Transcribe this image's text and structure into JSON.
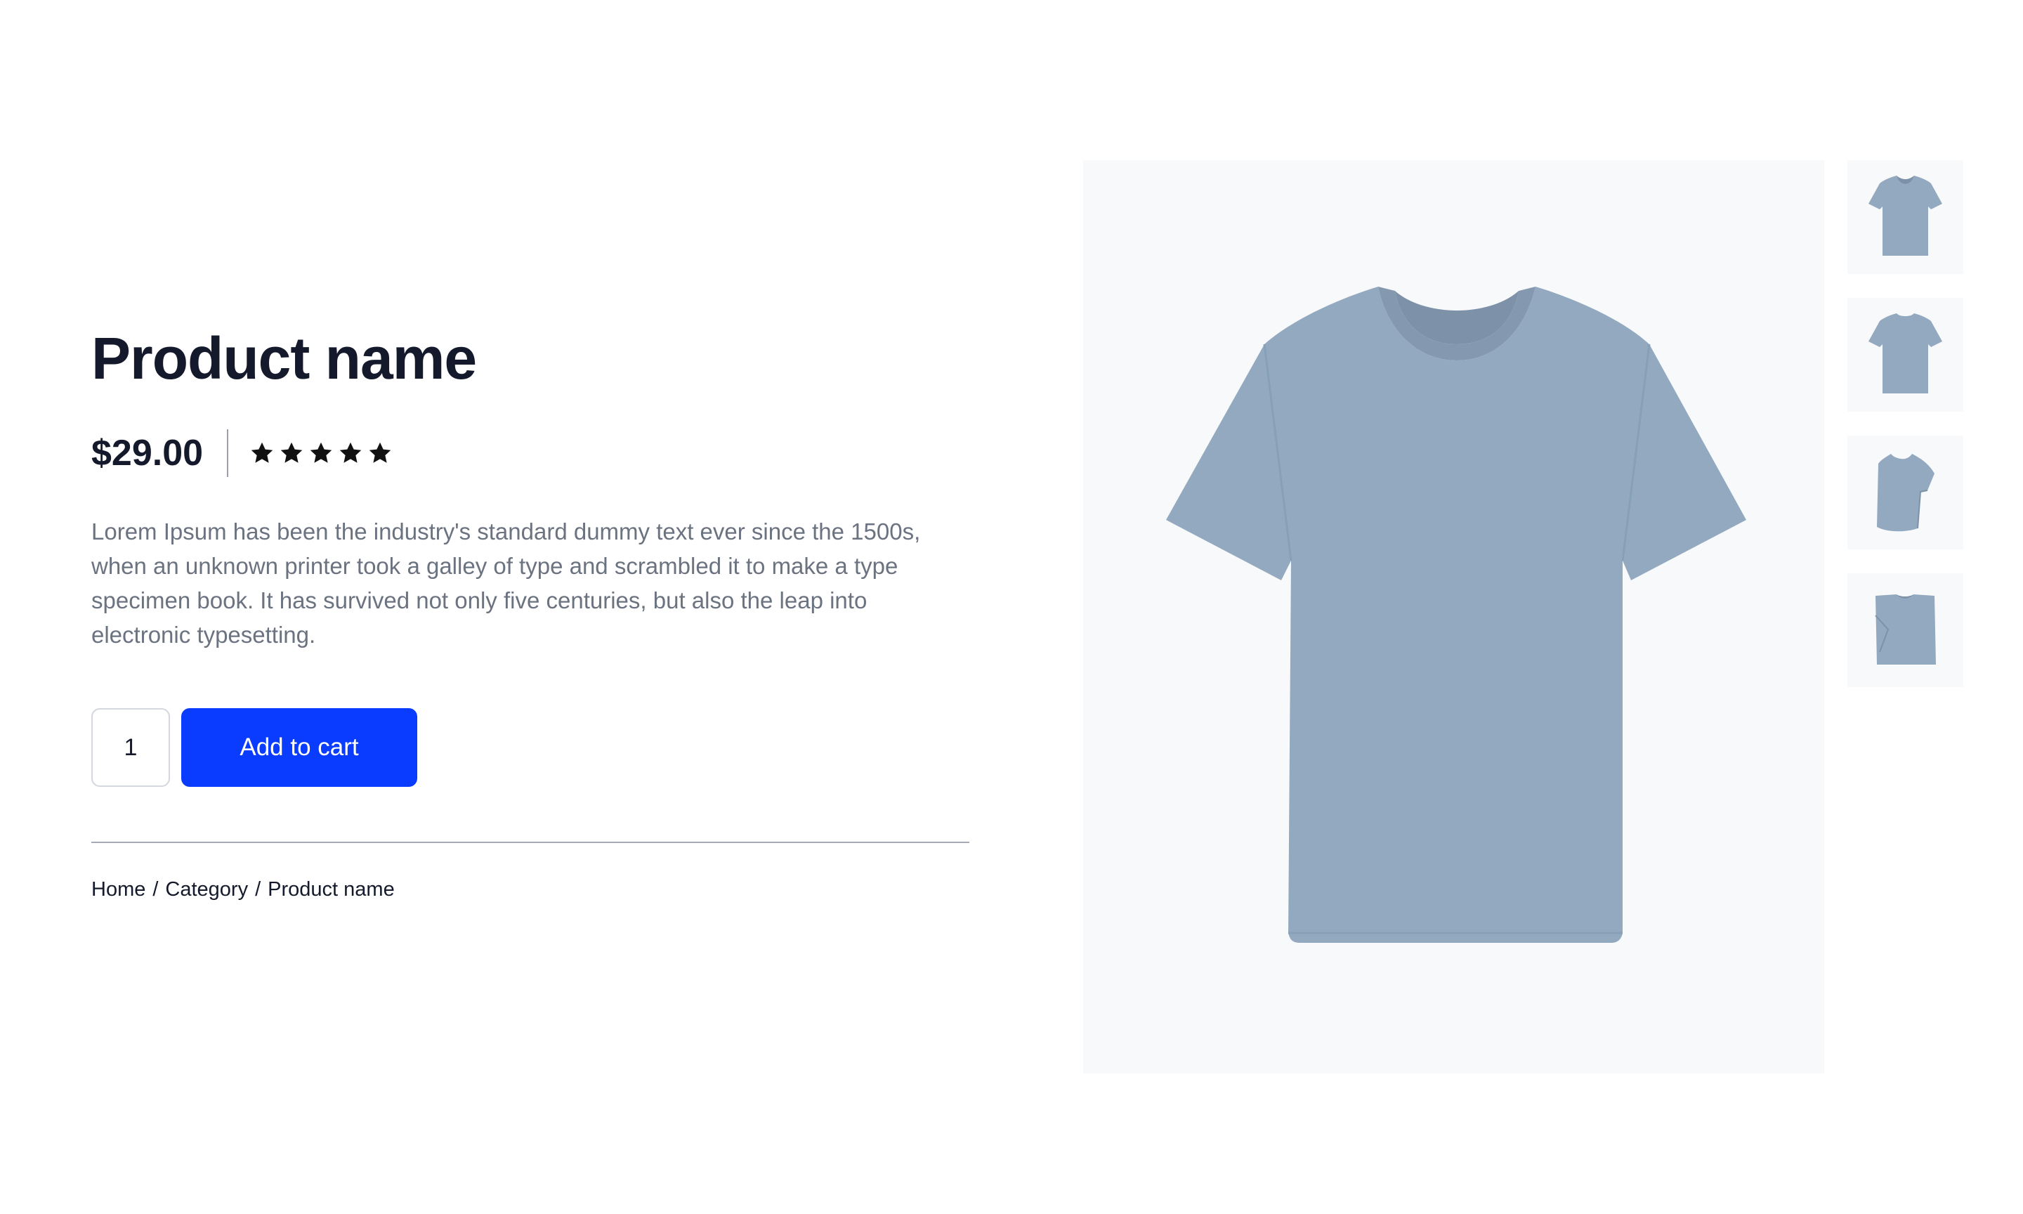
{
  "product": {
    "title": "Product name",
    "price": "$29.00",
    "rating": 5,
    "rating_max": 5,
    "description": "Lorem Ipsum has been the industry's standard dummy text ever since the 1500s, when an unknown printer took a galley of type and scrambled it to make a type specimen book. It has survived not only five centuries, but also the leap into electronic typesetting.",
    "quantity": "1",
    "add_to_cart_label": "Add to cart"
  },
  "breadcrumb": {
    "home": "Home",
    "category": "Category",
    "current": "Product name",
    "separator": "/"
  },
  "gallery": {
    "main_image": "blue-tshirt-front",
    "thumbnails": [
      "blue-tshirt-front",
      "blue-tshirt-back",
      "blue-tshirt-side",
      "blue-tshirt-folded"
    ]
  },
  "colors": {
    "accent": "#0a3cff",
    "heading": "#141a2b",
    "body_text": "#6b7280",
    "star": "#111111",
    "shirt": "#93a9bf",
    "image_bg": "#f8f9fa"
  }
}
